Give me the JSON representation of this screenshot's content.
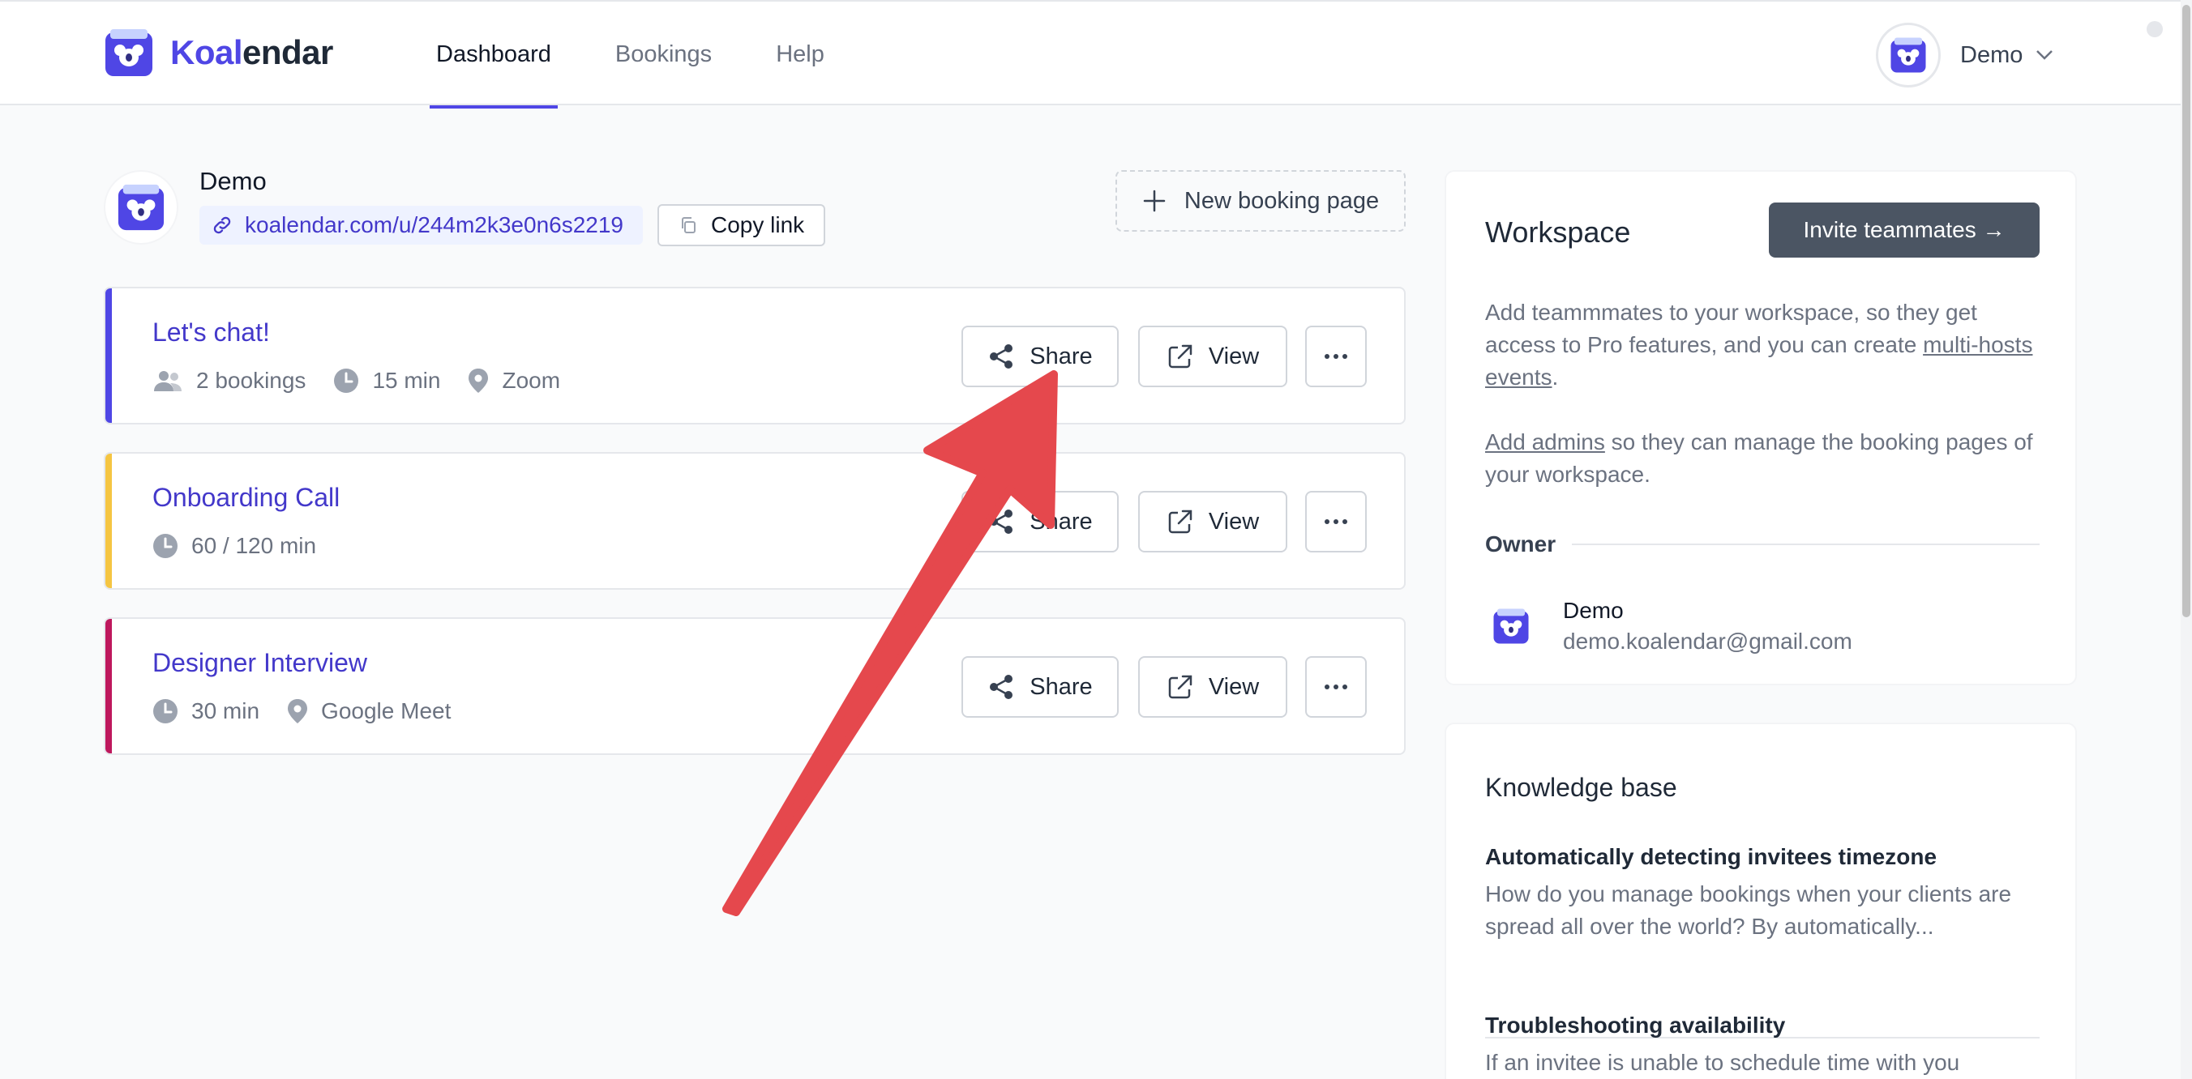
{
  "brand": {
    "name_accent": "Koal",
    "name_rest": "endar",
    "accent_color": "#4f46e5"
  },
  "nav": {
    "items": [
      {
        "label": "Dashboard",
        "active": true
      },
      {
        "label": "Bookings",
        "active": false
      },
      {
        "label": "Help",
        "active": false
      }
    ]
  },
  "user_menu": {
    "name": "Demo"
  },
  "profile": {
    "name": "Demo",
    "link": "koalendar.com/u/244m2k3e0n6s2219",
    "copy_label": "Copy link"
  },
  "new_booking_label": "New booking page",
  "events": [
    {
      "title": "Let's chat!",
      "color": "#4f46e5",
      "meta": [
        {
          "icon": "users-icon",
          "text": "2 bookings"
        },
        {
          "icon": "clock-icon",
          "text": "15 min"
        },
        {
          "icon": "location-pin-icon",
          "text": "Zoom"
        }
      ]
    },
    {
      "title": "Onboarding Call",
      "color": "#f5c542",
      "meta": [
        {
          "icon": "clock-icon",
          "text": "60 / 120 min"
        }
      ]
    },
    {
      "title": "Designer Interview",
      "color": "#be185d",
      "meta": [
        {
          "icon": "clock-icon",
          "text": "30 min"
        },
        {
          "icon": "location-pin-icon",
          "text": "Google Meet"
        }
      ]
    }
  ],
  "event_actions": {
    "share": "Share",
    "view": "View"
  },
  "workspace": {
    "title": "Workspace",
    "invite_label": "Invite teammates →",
    "text1_a": "Add teammmates to your workspace, so they get access to Pro features, and you can create ",
    "text1_link": "multi-hosts events",
    "text1_b": ".",
    "text2_link": "Add admins",
    "text2_b": " so they can manage the booking pages of your workspace.",
    "owner_label": "Owner",
    "owner_name": "Demo",
    "owner_email": "demo.koalendar@gmail.com"
  },
  "knowledge_base": {
    "title": "Knowledge base",
    "items": [
      {
        "title": "Automatically detecting invitees timezone",
        "text": "How do you manage bookings when your clients are spread all over the world? By automatically..."
      },
      {
        "title": "Troubleshooting availability",
        "text": "If an invitee is unable to schedule time with you"
      }
    ]
  },
  "annotation": {
    "arrow_color": "#e5484d"
  }
}
